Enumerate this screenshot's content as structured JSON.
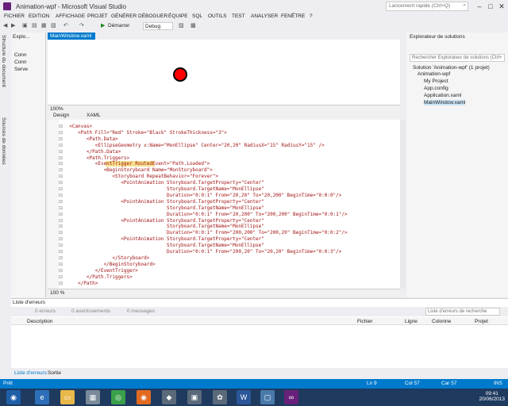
{
  "window": {
    "title": "Animation-wpf - Microsoft Visual Studio",
    "quick_launch": "Lancement rapide (Ctrl+Q)"
  },
  "menu": [
    "FICHIER",
    "EDITION",
    "AFFICHAGE",
    "PROJET",
    "GÉNÉRER",
    "DÉBOGUER",
    "ÉQUIPE",
    "SQL",
    "OUTILS",
    "TEST",
    "ANALYSER",
    "FENÊTRE",
    "?"
  ],
  "toolbar": {
    "start_label": "Démarrer",
    "config": "Debug"
  },
  "left_tabs": [
    "Structure du document",
    "Sources de données"
  ],
  "explorer": {
    "title": "Explo...",
    "items": [
      "Conn",
      "Conn",
      "Serve"
    ]
  },
  "doc_tab": "MainWindow.xaml",
  "design": {
    "zoom": "100%"
  },
  "view_tabs": {
    "design": "Design",
    "xaml": "XAML"
  },
  "code_lines": [
    "  <Canvas>",
    "     <Path Fill=\"Red\" Stroke=\"Black\" StrokeThickness=\"3\">",
    "        <Path.Data>",
    "           <EllipseGeometry x:Name=\"MonEllipse\" Center=\"20,20\" RadiusX=\"15\" RadiusY=\"15\" />",
    "        </Path.Data>",
    "        <Path.Triggers>",
    "           <EventTrigger RoutedEvent=\"Path.Loaded\">",
    "              <BeginStoryboard Name=\"MonStoryboard\">",
    "                 <Storyboard RepeatBehavior=\"Forever\">",
    "                    <PointAnimation Storyboard.TargetProperty=\"Center\"",
    "                                    Storyboard.TargetName=\"MonEllipse\"",
    "                                    Duration=\"0:0:1\" From=\"20,20\" To=\"20,200\" BeginTime=\"0:0:0\"/>",
    "                    <PointAnimation Storyboard.TargetProperty=\"Center\"",
    "                                    Storyboard.TargetName=\"MonEllipse\"",
    "                                    Duration=\"0:0:1\" From=\"20,200\" To=\"200,200\" BeginTime=\"0:0:1\"/>",
    "                    <PointAnimation Storyboard.TargetProperty=\"Center\"",
    "                                    Storyboard.TargetName=\"MonEllipse\"",
    "                                    Duration=\"0:0:1\" From=\"200,200\" To=\"200,20\" BeginTime=\"0:0:2\"/>",
    "                    <PointAnimation Storyboard.TargetProperty=\"Center\"",
    "                                    Storyboard.TargetName=\"MonEllipse\"",
    "                                    Duration=\"0:0:1\" From=\"200,20\" To=\"20,20\" BeginTime=\"0:0:3\"/>",
    "                 </Storyboard>",
    "              </BeginStoryboard>",
    "           </EventTrigger>",
    "        </Path.Triggers>",
    "     </Path>"
  ],
  "editor_zoom": "100 %",
  "solution": {
    "title": "Explorateur de solutions",
    "search": "Rechercher Explorateur de solutions (Ctrl+",
    "items": [
      "Solution 'Animation-wpf' (1 projet)",
      "Animation-wpf",
      "My Project",
      "App.config",
      "Application.xaml",
      "MainWindow.xaml"
    ]
  },
  "errors": {
    "title": "Liste d'erreurs",
    "errors_count": "0 erreurs",
    "warnings_count": "0 avertissements",
    "messages_count": "0 messages",
    "search": "Liste d'erreurs de recherche",
    "columns": [
      "Description",
      "Fichier",
      "Ligne",
      "Colonne",
      "Projet"
    ]
  },
  "bottom_tabs": [
    "Liste d'erreurs",
    "Sortie"
  ],
  "status": {
    "ready": "Prêt",
    "line": "Ln 9",
    "col": "Col 57",
    "ch": "Car 57",
    "ins": "INS"
  },
  "clock": {
    "time": "09:41",
    "date": "20/06/2013"
  }
}
